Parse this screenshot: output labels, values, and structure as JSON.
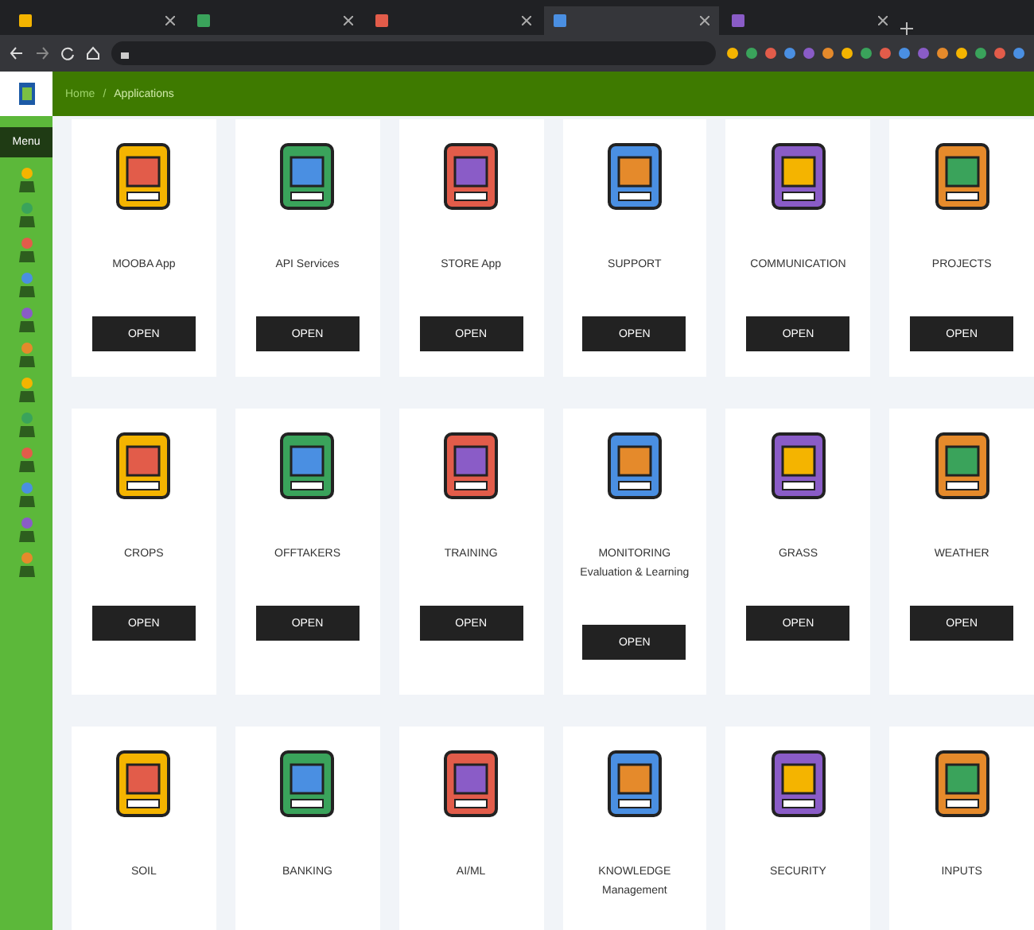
{
  "browser": {
    "tabs": [
      {
        "selected": false
      },
      {
        "selected": false
      },
      {
        "selected": false
      },
      {
        "selected": true
      },
      {
        "selected": false
      }
    ]
  },
  "header": {
    "separator": "/",
    "breadcrumb": [
      {
        "label": "Home",
        "selected": false
      },
      {
        "label": "Applications",
        "selected": true
      }
    ]
  },
  "sidebar": {
    "title": "Menu"
  },
  "apps": [
    {
      "title": "MOOBA App",
      "button": "OPEN"
    },
    {
      "title": "API Services",
      "button": "OPEN"
    },
    {
      "title": "STORE App",
      "button": "OPEN"
    },
    {
      "title": "SUPPORT",
      "button": "OPEN"
    },
    {
      "title": "COMMUNICATION",
      "button": "OPEN"
    },
    {
      "title": "PROJECTS",
      "button": "OPEN"
    },
    {
      "title": "CROPS",
      "button": "OPEN"
    },
    {
      "title": "OFFTAKERS",
      "button": "OPEN"
    },
    {
      "title": "TRAINING",
      "button": "OPEN"
    },
    {
      "title": "MONITORING Evaluation & Learning",
      "button": "OPEN"
    },
    {
      "title": "GRASS",
      "button": "OPEN"
    },
    {
      "title": "WEATHER",
      "button": "OPEN"
    },
    {
      "title": "SOIL"
    },
    {
      "title": "BANKING"
    },
    {
      "title": "AI/ML"
    },
    {
      "title": "KNOWLEDGE Management"
    },
    {
      "title": "SECURITY"
    },
    {
      "title": "INPUTS"
    }
  ]
}
